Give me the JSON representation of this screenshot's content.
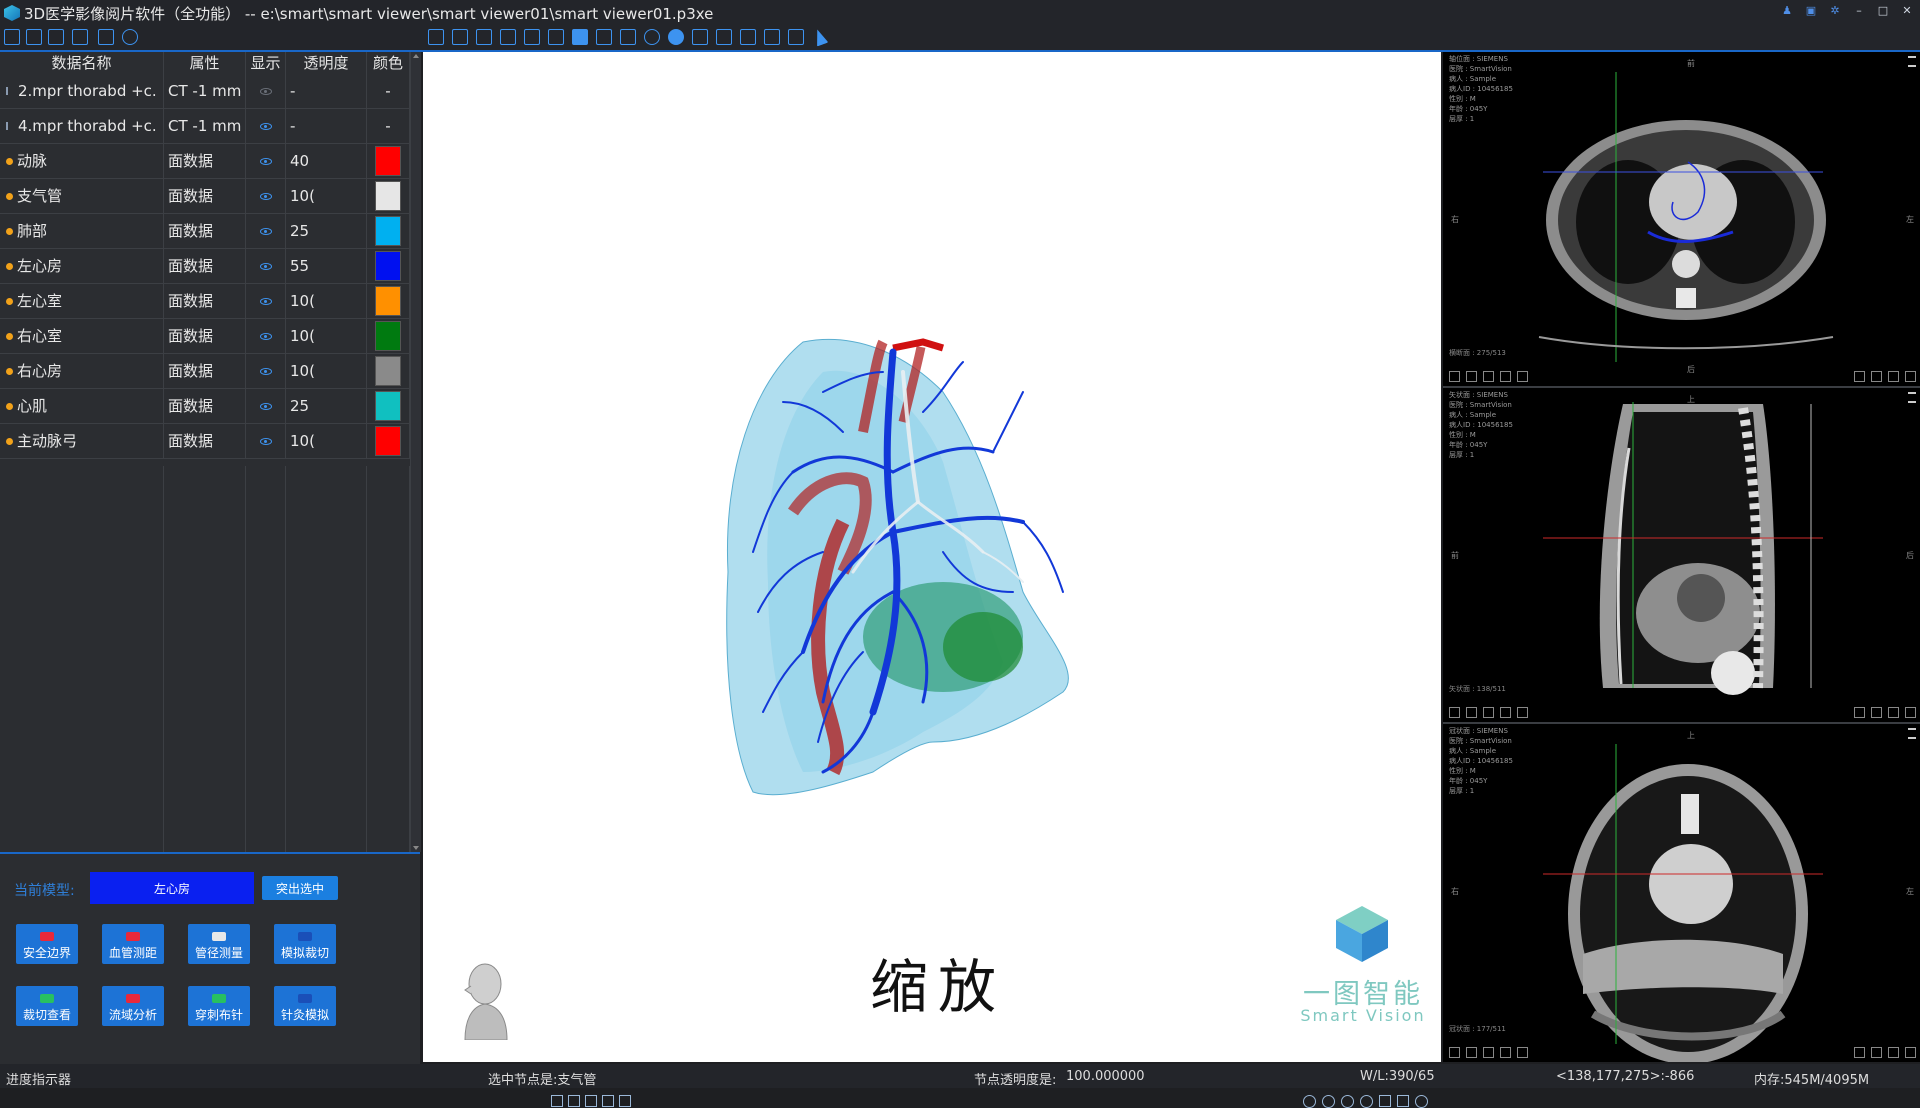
{
  "window": {
    "title": "3D医学影像阅片软件（全功能） -- e:\\smart\\smart viewer\\smart viewer01\\smart viewer01.p3xe"
  },
  "table": {
    "headers": [
      "数据名称",
      "属性",
      "显示",
      "透明度",
      "颜色"
    ],
    "rows": [
      {
        "name": "2.mpr  thorabd  +c.",
        "prop": "CT -1 mm",
        "visible": false,
        "opacity": "-",
        "color": "-",
        "kind": "mpr"
      },
      {
        "name": "4.mpr  thorabd  +c.",
        "prop": "CT -1 mm",
        "visible": true,
        "opacity": "-",
        "color": "-",
        "kind": "mpr"
      },
      {
        "name": "动脉",
        "prop": "面数据",
        "visible": true,
        "opacity": "40",
        "color": "#ff0000",
        "kind": "mesh"
      },
      {
        "name": "支气管",
        "prop": "面数据",
        "visible": true,
        "opacity": "10(",
        "color": "#e6e6e6",
        "kind": "mesh"
      },
      {
        "name": "肺部",
        "prop": "面数据",
        "visible": true,
        "opacity": "25",
        "color": "#00b0f0",
        "kind": "mesh"
      },
      {
        "name": "左心房",
        "prop": "面数据",
        "visible": true,
        "opacity": "55",
        "color": "#0010f0",
        "kind": "mesh"
      },
      {
        "name": "左心室",
        "prop": "面数据",
        "visible": true,
        "opacity": "10(",
        "color": "#ff9000",
        "kind": "mesh"
      },
      {
        "name": "右心室",
        "prop": "面数据",
        "visible": true,
        "opacity": "10(",
        "color": "#007a10",
        "kind": "mesh"
      },
      {
        "name": "右心房",
        "prop": "面数据",
        "visible": true,
        "opacity": "10(",
        "color": "#8a8a8a",
        "kind": "mesh"
      },
      {
        "name": "心肌",
        "prop": "面数据",
        "visible": true,
        "opacity": "25",
        "color": "#10c0c0",
        "kind": "mesh"
      },
      {
        "name": "主动脉弓",
        "prop": "面数据",
        "visible": true,
        "opacity": "10(",
        "color": "#ff0000",
        "kind": "mesh"
      }
    ]
  },
  "model_panel": {
    "current_label": "当前模型:",
    "current_value": "左心房",
    "highlight_button": "突出选中",
    "tools": [
      {
        "label": "安全边界",
        "icon_color": "#e8283a"
      },
      {
        "label": "血管测距",
        "icon_color": "#e8283a"
      },
      {
        "label": "管径测量",
        "icon_color": "#e8e8e8"
      },
      {
        "label": "模拟裁切",
        "icon_color": "#1a4fb8"
      },
      {
        "label": "裁切查看",
        "icon_color": "#28c060"
      },
      {
        "label": "流域分析",
        "icon_color": "#e8283a"
      },
      {
        "label": "穿刺布针",
        "icon_color": "#28c060"
      },
      {
        "label": "针灸模拟",
        "icon_color": "#1a4fb8"
      }
    ]
  },
  "viewport": {
    "caption": "缩放",
    "logo_cn": "一图智能",
    "logo_en": "Smart Vision"
  },
  "ct_views": [
    {
      "name": "axial",
      "info": "轴位面 : SIEMENS\n医院 : SmartVision\n病人 : Sample\n病人ID : 10456185\n性别 : M\n年龄 : 045Y\n层厚 : 1",
      "orient_top": "前",
      "orient_left": "右",
      "orient_right": "左",
      "orient_bottom": "后",
      "slice": "横断面 : 275/513"
    },
    {
      "name": "sagittal",
      "info": "矢状面 : SIEMENS\n医院 : SmartVision\n病人 : Sample\n病人ID : 10456185\n性别 : M\n年龄 : 045Y\n层厚 : 1",
      "orient_top": "上",
      "orient_left": "前",
      "orient_right": "后",
      "orient_bottom": "",
      "slice": "矢状面 : 138/511"
    },
    {
      "name": "coronal",
      "info": "冠状面 : SIEMENS\n医院 : SmartVision\n病人 : Sample\n病人ID : 10456185\n性别 : M\n年龄 : 045Y\n层厚 : 1",
      "orient_top": "上",
      "orient_left": "右",
      "orient_right": "左",
      "orient_bottom": "",
      "slice": "冠状面 : 177/511"
    }
  ],
  "status": {
    "progress": "进度指示器",
    "selected_node": "选中节点是:支气管",
    "node_opacity_label": "节点透明度是:",
    "node_opacity_value": "100.000000",
    "wl": "W/L:390/65",
    "coords": "<138,177,275>:-866",
    "memory": "内存:545M/4095M"
  },
  "colors": {
    "accent": "#1967c8",
    "button": "#1d73d6",
    "model_value_bg": "#0a20f0"
  }
}
